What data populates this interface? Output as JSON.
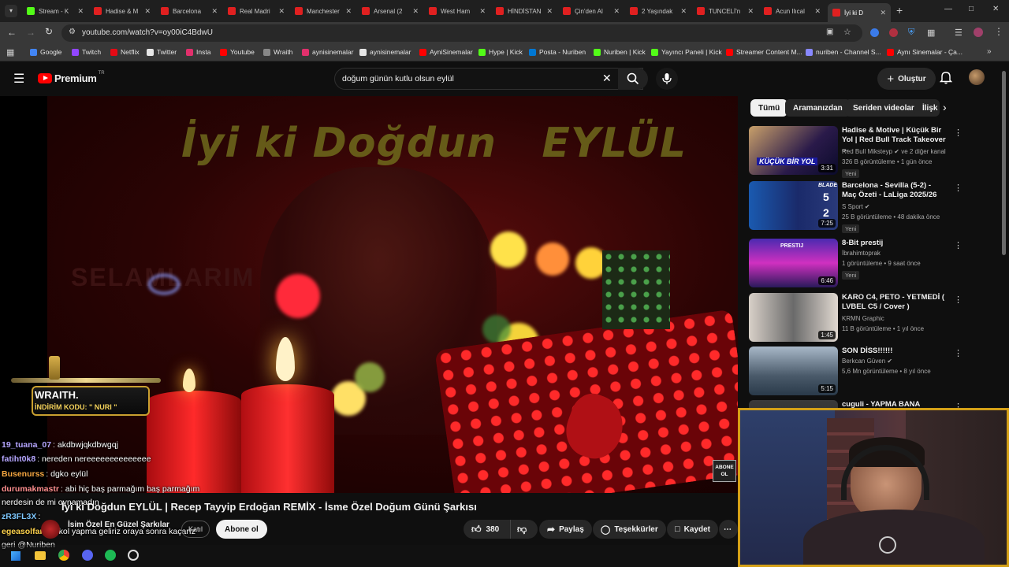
{
  "browser": {
    "tabs": [
      {
        "label": "Stream - K",
        "icon": "kick-favicon"
      },
      {
        "label": "Hadise & M",
        "icon": "youtube-favicon"
      },
      {
        "label": "Barcelona",
        "icon": "youtube-favicon"
      },
      {
        "label": "Real Madri",
        "icon": "youtube-favicon"
      },
      {
        "label": "Manchester",
        "icon": "youtube-favicon"
      },
      {
        "label": "Arsenal (2",
        "icon": "youtube-favicon"
      },
      {
        "label": "West Ham",
        "icon": "youtube-favicon"
      },
      {
        "label": "HİNDİSTAN",
        "icon": "youtube-favicon"
      },
      {
        "label": "Çin'den Al",
        "icon": "youtube-favicon"
      },
      {
        "label": "2 Yaşındak",
        "icon": "youtube-favicon"
      },
      {
        "label": "TUNCELİ'n",
        "icon": "youtube-favicon"
      },
      {
        "label": "Acun Ilıcal",
        "icon": "youtube-favicon"
      },
      {
        "label": "İyi ki D",
        "icon": "youtube-favicon",
        "active": true
      }
    ],
    "url": "youtube.com/watch?v=oy00iC4BdwU",
    "bookmarks": [
      {
        "label": "Google",
        "color": "#4285f4"
      },
      {
        "label": "Twitch",
        "color": "#9146ff"
      },
      {
        "label": "Netflix",
        "color": "#e50914"
      },
      {
        "label": "Twitter",
        "color": "#e6e6e6"
      },
      {
        "label": "Insta",
        "color": "#e1306c"
      },
      {
        "label": "Youtube",
        "color": "#ff0000"
      },
      {
        "label": "Wraith",
        "color": "#888888"
      },
      {
        "label": "aynisinemalar",
        "color": "#e1306c"
      },
      {
        "label": "aynisinemalar",
        "color": "#e6e6e6"
      },
      {
        "label": "AyniSinemalar",
        "color": "#ff0000"
      },
      {
        "label": "Hype | Kick",
        "color": "#53fc18"
      },
      {
        "label": "Posta - Nuriben",
        "color": "#0078d4"
      },
      {
        "label": "Nuriben | Kick",
        "color": "#53fc18"
      },
      {
        "label": "Yayıncı Paneli | Kick",
        "color": "#53fc18"
      },
      {
        "label": "Streamer Content M...",
        "color": "#ff0000"
      },
      {
        "label": "nuriben - Channel S...",
        "color": "#8888ff"
      },
      {
        "label": "Aynı Sinemalar - Ça...",
        "color": "#ff0000"
      }
    ]
  },
  "youtube": {
    "logo": "Premium",
    "logo_sup": "TR",
    "search_value": "doğum günün kutlu olsun eylül",
    "create_label": "Oluştur"
  },
  "video": {
    "overlay_title": "İyi ki Doğdun   EYLÜL",
    "sponsor_name": "WRAITH.",
    "sponsor_code": "İNDİRİM KODU: \" NURI \"",
    "abone_badge": "ABONE OL",
    "title": "İyi ki Doğdun EYLÜL | Recep Tayyip Erdoğan REMİX - İsme Özel Doğum Günü Şarkısı",
    "channel_name": "İsim Özel En Güzel Şarkılar",
    "subscribe_label": "Abone ol",
    "join_label": "Katıl",
    "like_count": "380",
    "share_label": "Paylaş",
    "thanks_label": "Teşekkürler",
    "save_label": "Kaydet"
  },
  "chat": [
    {
      "user": "19_tuana_07",
      "msg": ": akdbwjqkdbwgqj",
      "color": "#b5a6ff"
    },
    {
      "user": "fatiht0k8",
      "msg": ": nereden nereeeeeeeeeeeeee",
      "color": "#b5a6ff"
    },
    {
      "user": "Busenurss",
      "msg": ": dgko eylül",
      "color": "#f4a640"
    },
    {
      "user": "durumakmastr",
      "msg": ": abi hiç baş parmağım baş parmağım",
      "color": "#ff8f8f"
    },
    {
      "user": "",
      "msg": "nerdesin de mi oynamadın",
      "color": "#ffffff"
    },
    {
      "user": "zR3FL3X",
      "msg": ":",
      "color": "#7ec8ff"
    },
    {
      "user": "egeasolfar",
      "msg": ": El kol yapma geliriz oraya sonra kaçarız",
      "color": "#ffd34d"
    },
    {
      "user": "",
      "msg": "geri @Nuriben",
      "color": "#ffffff"
    }
  ],
  "sidebar": {
    "chips": [
      "Tümü",
      "Aramanızdan",
      "Seriden videolar",
      "İlişk"
    ],
    "recommendations": [
      {
        "title": "Hadise & Motive | Küçük Bir Yol | Red Bull Track Takeover ...",
        "channel": "Red Bull Miksteyp",
        "channel_extra": "ve 2 diğer kanal",
        "meta": "326 B görüntüleme • 1 gün önce",
        "badge": "Yeni",
        "duration": "3:31"
      },
      {
        "title": "Barcelona - Sevilla (5-2) - Maç Özeti - LaLiga 2025/26",
        "channel": "S Sport",
        "channel_extra": "",
        "meta": "25 B görüntüleme • 48 dakika önce",
        "badge": "Yeni",
        "duration": "7:25"
      },
      {
        "title": "8-Bit prestij",
        "channel": "İbrahimtoprak",
        "channel_extra": "",
        "meta": "1 görüntüleme • 9 saat önce",
        "badge": "Yeni",
        "duration": "6:46"
      },
      {
        "title": "KARO C4, PETO - YETMEDİ ( LVBEL C5 / Cover )",
        "channel": "KRMN Graphic",
        "channel_extra": "",
        "meta": "11 B görüntüleme • 1 yıl önce",
        "badge": "",
        "duration": "1:45"
      },
      {
        "title": "SON DİSS!!!!!!",
        "channel": "Berkcan Güven",
        "channel_extra": "",
        "meta": "5,6 Mn görüntüleme • 8 yıl önce",
        "badge": "",
        "duration": "5:15"
      },
      {
        "title": "cuguli - YAPMA BANA NUMARA",
        "channel": "",
        "channel_extra": "",
        "meta": "",
        "badge": "",
        "duration": ""
      }
    ]
  },
  "thumb_texts": {
    "t1": "KÜÇÜK BİR YOL",
    "t2_team": "BLADE",
    "t2_score1": "5",
    "t2_score2": "2",
    "t3": "PRESTIJ"
  }
}
